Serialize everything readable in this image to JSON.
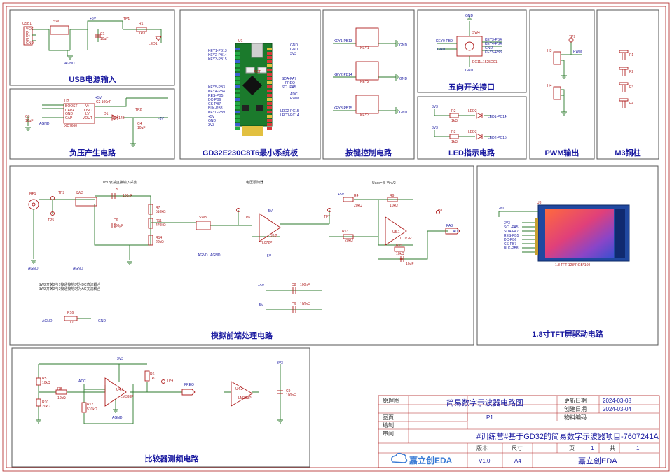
{
  "panels": {
    "usb": {
      "title": "USB电源输入"
    },
    "neg": {
      "title": "负压产生电路"
    },
    "mcu": {
      "title": "GD32E230C8T6最小系统板"
    },
    "keys": {
      "title": "按键控制电路"
    },
    "five": {
      "title": "五向开关接口"
    },
    "led": {
      "title": "LED指示电路"
    },
    "pwm": {
      "title": "PWM输出"
    },
    "m3": {
      "title": "M3铜柱"
    },
    "afe": {
      "title": "模拟前端处理电路"
    },
    "tft": {
      "title": "1.8寸TFT屏驱动电路"
    },
    "cmp": {
      "title": "比较器测频电路"
    }
  },
  "labels": {
    "usb": [
      "USB1",
      "SW1",
      "+5V",
      "TP1",
      "R1",
      "1kΩ",
      "C1",
      "10uF",
      "LED1",
      "AGND",
      "VCC",
      "D-",
      "D+",
      "ID",
      "GND"
    ],
    "neg": [
      "U2",
      "C2 100nF",
      "+5V",
      "BOOST",
      "CAP+",
      "GND",
      "CAP-",
      "V+",
      "OSC",
      "LV",
      "VOUT",
      "XD7660",
      "D1",
      "1N4148",
      "TP2",
      "C3",
      "10uF",
      "C4",
      "10uF",
      "AGND",
      "-5V"
    ],
    "mcu_left": [
      "KEY1-PB13",
      "KEY2-PB14",
      "KEY3-PB15",
      "KEY5-PB3",
      "KEY4-PB4",
      "RES-PB5",
      "DC-PB6",
      "CS-PB7",
      "BLK-PB8",
      "KEY0-PB9",
      "+5V",
      "GND",
      "3V3"
    ],
    "mcu_right": [
      "GND",
      "GND",
      "3V3",
      "SDA-PA7",
      "FREQ",
      "SCL-PA5",
      "ADC",
      "PWM",
      "LED2-PC15",
      "LED1-PC14"
    ],
    "mcu_misc": [
      "U1",
      "ACT"
    ],
    "keys": [
      "KEY1-PB13",
      "KEY1",
      "KEY2-PB14",
      "KEY2",
      "KEY3-PB15",
      "KEY3",
      "GND",
      "GND",
      "GND"
    ],
    "five": [
      "GND",
      "SW4",
      "KEY0-PB9",
      "GND",
      "KEY3-PB4",
      "KEY4-PB4",
      "GND",
      "KEY5-PB3",
      "GND",
      "EC11L1525G01"
    ],
    "led": [
      "3V3",
      "R2",
      "1kΩ",
      "LED2",
      "LED1-PC14",
      "3V3",
      "R3",
      "1kΩ",
      "LED3",
      "LED2-PC15"
    ],
    "pwm": [
      "TP9",
      "H3",
      "PWM",
      "H4"
    ],
    "m3": [
      "P1",
      "P2",
      "P3",
      "P4"
    ],
    "afe": [
      "RF1",
      "TP3",
      "TP5",
      "SW2",
      "C5",
      "100nF",
      "C6",
      "680pF",
      "1/50衰减直接输入采集",
      "R7",
      "510kΩ",
      "R11",
      "470kΩ",
      "R14",
      "20kΩ",
      "SW3",
      "TP6",
      "电压跟随器",
      "-5V",
      "U6.2",
      "+5V",
      "TL072P",
      "TFT",
      "Uadc=(5-Vin)/2",
      "+5V",
      "R4",
      "20kΩ",
      "R9",
      "10kΩ",
      "TP8",
      "R13",
      "20kΩ",
      "U5.1",
      "TL072P",
      "PA3",
      "ADC",
      "R15",
      "10kΩ",
      "C10",
      "10pF",
      "AGND",
      "AGND",
      "AGND",
      "AGND",
      "SW2开关2与1接通接地时为DC直流耦合",
      "SW2开关2与3接通接地时为AC交流耦合",
      "+5V",
      "C8",
      "100nF",
      "-5V",
      "C9",
      "100nF",
      "R16",
      "0Ω",
      "AGND",
      "GND"
    ],
    "tft": [
      "GND",
      "U3",
      "3V3",
      "SCL-PA5",
      "SDA-PA7",
      "RES-PB5",
      "DC-PB6",
      "CS-PB7",
      "BLK-PB8",
      "1.8 TFT 128*RGB*160"
    ],
    "cmp": [
      "3V3",
      "R5",
      "10kΩ",
      "R10",
      "20kΩ",
      "R8",
      "10kΩ",
      "ADC",
      "R12",
      "510kΩ",
      "U4.1",
      "LM393P",
      "R6",
      "1kΩ",
      "TP4",
      "FREQ",
      "U4.2",
      "LM393P",
      "3V3",
      "C9",
      "100nF",
      "AGND"
    ]
  },
  "title_block": {
    "drawing_label": "原理图",
    "drawing_name": "简易数字示波器电路图",
    "update_label": "更新日期",
    "update_date": "2024-03-08",
    "create_label": "创建日期",
    "create_date": "2024-03-04",
    "page_label": "图页",
    "page_value": "P1",
    "material_label": "物料编码",
    "draw_label": "绘制",
    "review_label": "审阅",
    "project": "#训练营#基于GD32的简易数字示波器项目-7607241A",
    "version_label": "版本",
    "size_label": "尺寸",
    "page_of_label": "页",
    "page_num": "1",
    "total_label": "共",
    "total_num": "1",
    "version": "V1.0",
    "size": "A4",
    "company": "嘉立创EDA",
    "logo": "嘉立创EDA"
  },
  "colors": {
    "wire": "#2b7a2b",
    "part": "#b02020",
    "net": "#1a1aa0",
    "title": "#1a1aa0"
  }
}
